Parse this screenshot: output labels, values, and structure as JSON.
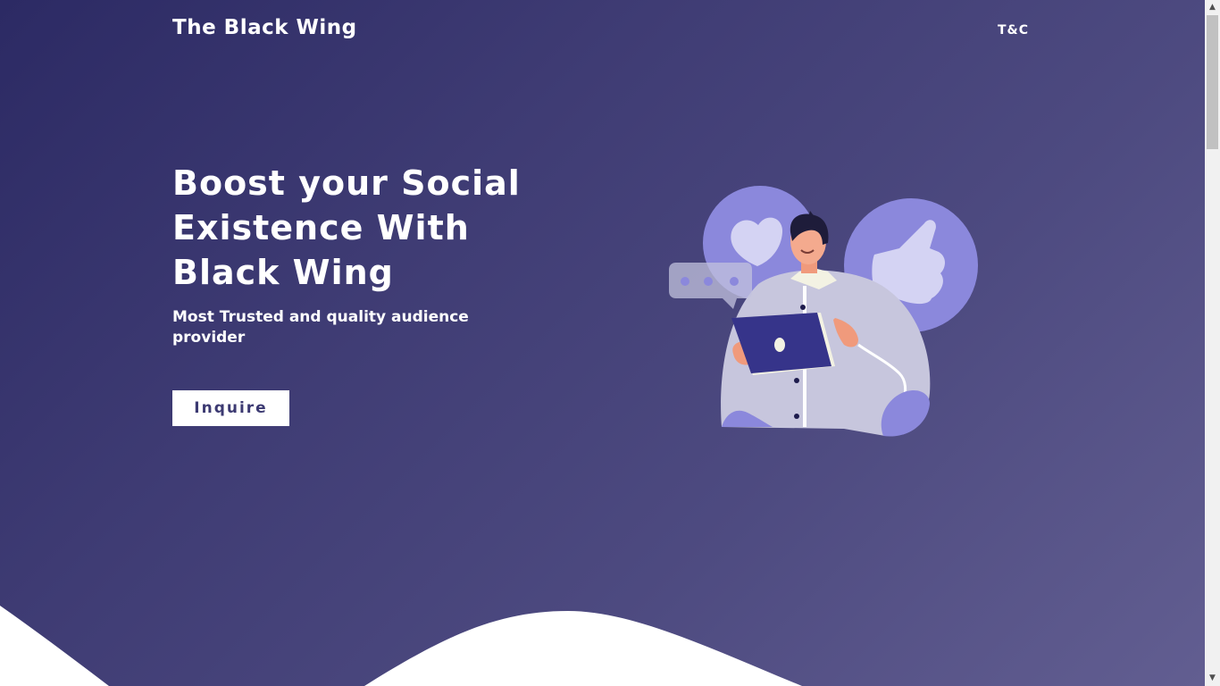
{
  "header": {
    "brand": "The Black Wing",
    "nav_link": "T&C"
  },
  "hero": {
    "title": "Boost your Social Existence With Black Wing",
    "subtitle": "Most Trusted and quality audience provider",
    "cta_label": "Inquire"
  },
  "illustration": {
    "icons": [
      "heart-icon",
      "thumbs-up-icon",
      "chat-bubble-icon",
      "person-with-tablet"
    ]
  },
  "colors": {
    "background_start": "#2c2a64",
    "background_end": "#625e91",
    "accent": "#8b88dc",
    "button_text": "#3c3a72"
  },
  "scrollbar": {
    "up_icon": "scroll-up-arrow-icon",
    "down_icon": "scroll-down-arrow-icon"
  }
}
